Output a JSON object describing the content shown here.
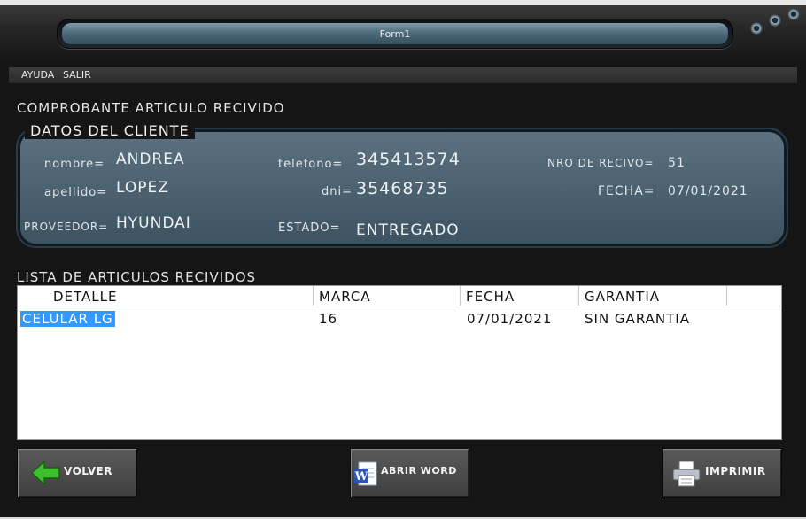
{
  "window": {
    "title": "Form1"
  },
  "menu": {
    "items": [
      "AYUDA",
      "SALIR"
    ]
  },
  "heading": "COMPROBANTE ARTICULO RECIVIDO",
  "client": {
    "legend": "DATOS DEL CLIENTE",
    "nombre_label": "nombre=",
    "nombre_value": "ANDREA",
    "apellido_label": "apellido=",
    "apellido_value": "LOPEZ",
    "proveedor_label": "PROVEEDOR=",
    "proveedor_value": "HYUNDAI",
    "telefono_label": "telefono=",
    "telefono_value": "345413574",
    "dni_label": "dni=",
    "dni_value": "35468735",
    "estado_label": "ESTADO=",
    "estado_value": "ENTREGADO",
    "recibo_label": "NRO DE RECIVO=",
    "recibo_value": "51",
    "fecha_label": "FECHA=",
    "fecha_value": "07/01/2021"
  },
  "list": {
    "heading": "LISTA DE ARTICULOS RECIVIDOS",
    "columns": [
      "DETALLE",
      "MARCA",
      "FECHA",
      "GARANTIA"
    ],
    "rows": [
      [
        "CELULAR LG",
        "16",
        "07/01/2021",
        "SIN GARANTIA"
      ]
    ]
  },
  "buttons": {
    "volver": "VOLVER",
    "abrir_word": "ABRIR WORD",
    "imprimir": "IMPRIMIR"
  },
  "icons": {
    "volver": "green-left-arrow-icon",
    "abrir_word": "word-document-icon",
    "imprimir": "printer-icon"
  }
}
